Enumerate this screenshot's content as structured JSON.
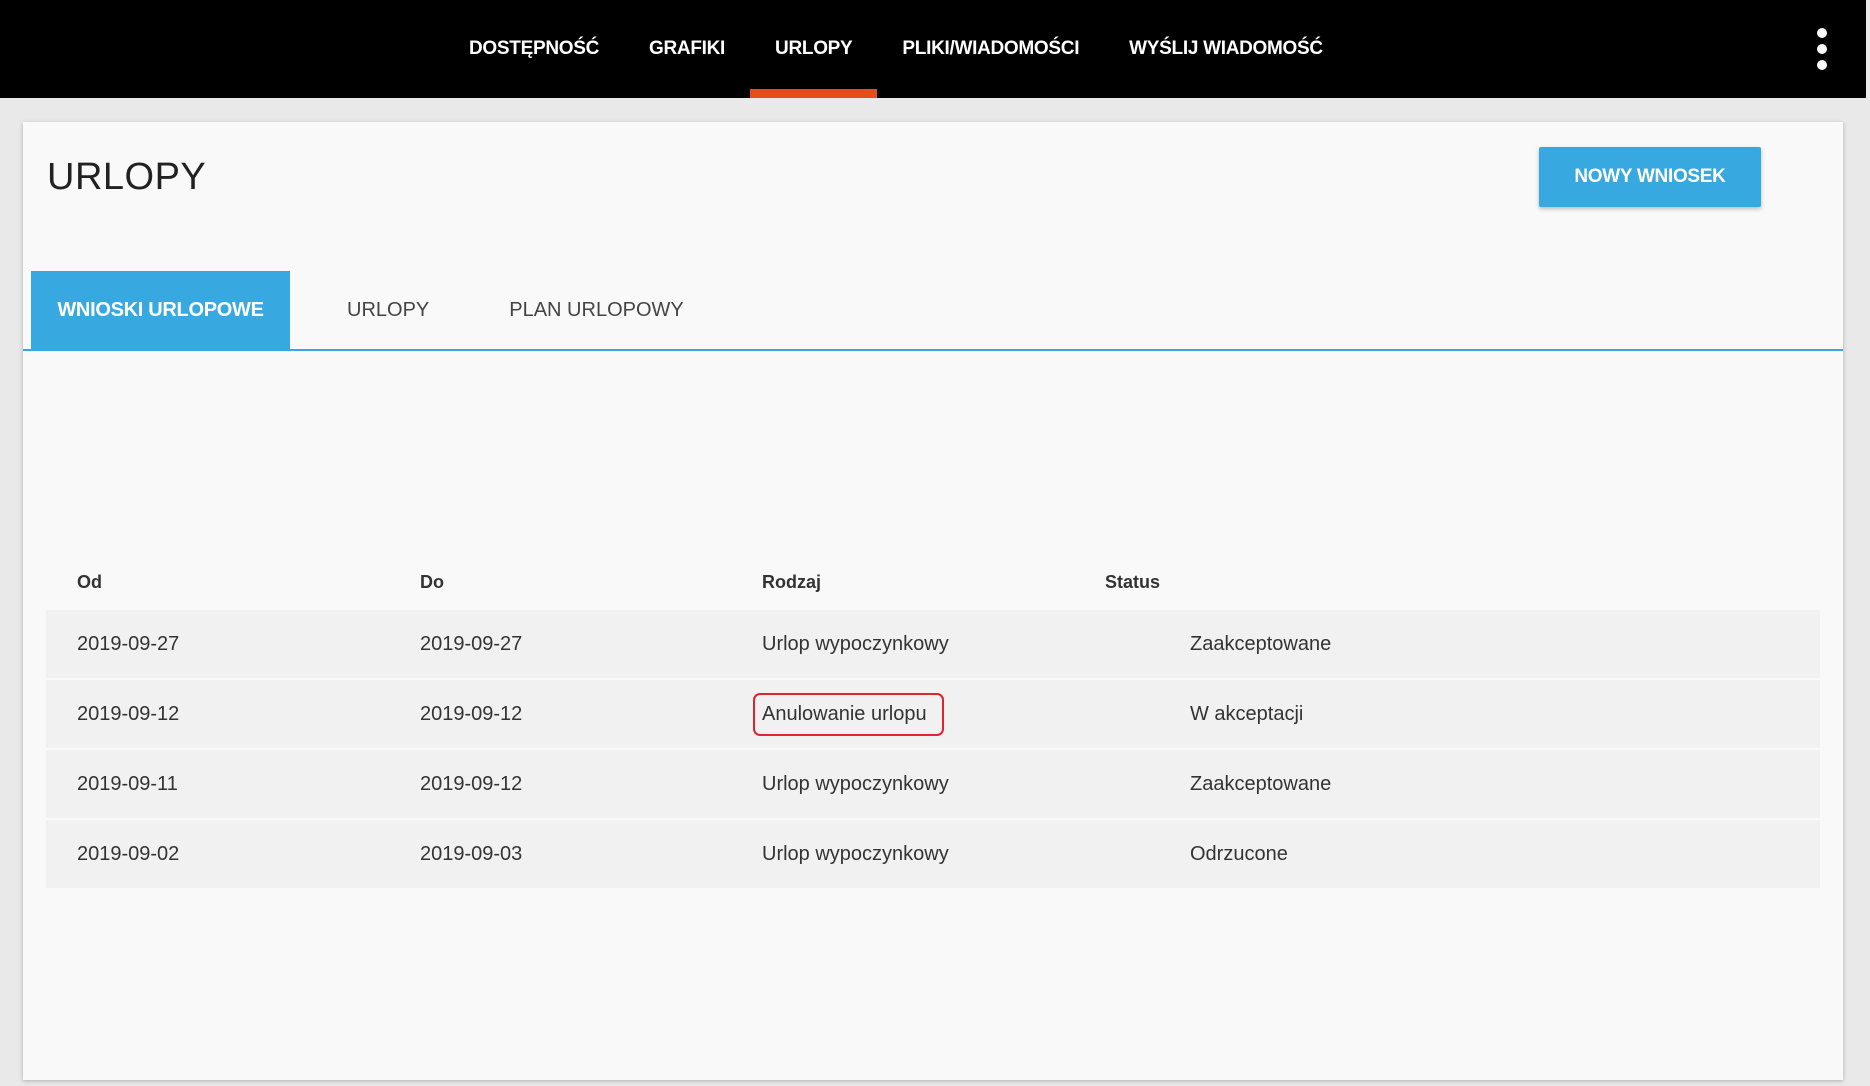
{
  "nav": {
    "items": [
      {
        "label": "DOSTĘPNOŚĆ"
      },
      {
        "label": "GRAFIKI"
      },
      {
        "label": "URLOPY"
      },
      {
        "label": "PLIKI/WIADOMOŚCI"
      },
      {
        "label": "WYŚLIJ WIADOMOŚĆ"
      }
    ],
    "active": "URLOPY",
    "menu_icon": "kebab-menu-icon"
  },
  "page": {
    "title": "URLOPY",
    "new_button": "NOWY WNIOSEK"
  },
  "tabs": [
    {
      "label": "WNIOSKI URLOPOWE",
      "active": true
    },
    {
      "label": "URLOPY",
      "active": false
    },
    {
      "label": "PLAN URLOPOWY",
      "active": false
    }
  ],
  "table": {
    "headers": [
      "Od",
      "Do",
      "Rodzaj",
      "Status"
    ],
    "rows": [
      {
        "from": "2019-09-27",
        "to": "2019-09-27",
        "type": "Urlop wypoczynkowy",
        "status": "Zaakceptowane"
      },
      {
        "from": "2019-09-12",
        "to": "2019-09-12",
        "type": "Anulowanie urlopu",
        "status": "W akceptacji"
      },
      {
        "from": "2019-09-11",
        "to": "2019-09-12",
        "type": "Urlop wypoczynkowy",
        "status": "Zaakceptowane"
      },
      {
        "from": "2019-09-02",
        "to": "2019-09-03",
        "type": "Urlop wypoczynkowy",
        "status": "Odrzucone"
      }
    ]
  },
  "colors": {
    "accent": "#38a9e0",
    "nav_active_underline": "#e84c1c",
    "highlight_box": "#e0232c",
    "topbar": "#000000"
  }
}
